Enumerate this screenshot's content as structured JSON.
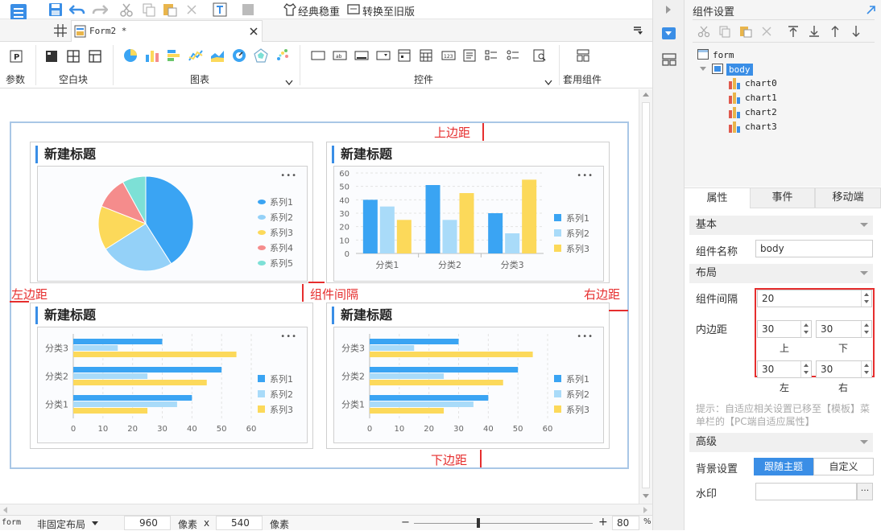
{
  "toolbar": {
    "classic_label": "经典稳重",
    "switch_label": "转换至旧版"
  },
  "tab": {
    "title": "Form2 *"
  },
  "ribbon": {
    "groups": [
      "参数",
      "空白块",
      "图表",
      "控件",
      "套用组件"
    ]
  },
  "canvas": {
    "labels": {
      "top": "上边距",
      "bottom": "下边距",
      "left": "左边距",
      "right": "右边距",
      "gap": "组件间隔"
    },
    "cards": [
      {
        "title": "新建标题"
      },
      {
        "title": "新建标题"
      },
      {
        "title": "新建标题"
      },
      {
        "title": "新建标题"
      }
    ],
    "more": "•••"
  },
  "chart_data": [
    {
      "type": "pie",
      "title": "新建标题",
      "categories": [
        "系列1",
        "系列2",
        "系列3",
        "系列4",
        "系列5"
      ],
      "values": [
        41,
        25,
        15,
        11,
        8
      ],
      "colors": [
        "#3aa4f3",
        "#94d1f8",
        "#fcd95a",
        "#f58c8c",
        "#7de0d6"
      ],
      "legend": "right"
    },
    {
      "type": "bar",
      "title": "新建标题",
      "categories": [
        "分类1",
        "分类2",
        "分类3"
      ],
      "series": [
        {
          "name": "系列1",
          "values": [
            40,
            51,
            30
          ],
          "color": "#3aa4f3"
        },
        {
          "name": "系列2",
          "values": [
            35,
            25,
            15
          ],
          "color": "#a9dbf9"
        },
        {
          "name": "系列3",
          "values": [
            25,
            45,
            55
          ],
          "color": "#fcd95a"
        }
      ],
      "ylim": [
        0,
        60
      ],
      "yticks": [
        "0",
        "10",
        "20",
        "30",
        "40",
        "50",
        "60"
      ],
      "legend": "right"
    },
    {
      "type": "bar",
      "orientation": "horizontal",
      "title": "新建标题",
      "categories": [
        "分类1",
        "分类2",
        "分类3"
      ],
      "series": [
        {
          "name": "系列1",
          "values": [
            40,
            50,
            30
          ],
          "color": "#3aa4f3"
        },
        {
          "name": "系列2",
          "values": [
            35,
            25,
            15
          ],
          "color": "#a9dbf9"
        },
        {
          "name": "系列3",
          "values": [
            25,
            45,
            55
          ],
          "color": "#fcd95a"
        }
      ],
      "xlim": [
        0,
        60
      ],
      "xticks": [
        "0",
        "10",
        "20",
        "30",
        "40",
        "50",
        "60"
      ],
      "legend": "right"
    },
    {
      "type": "bar",
      "orientation": "horizontal",
      "title": "新建标题",
      "categories": [
        "分类1",
        "分类2",
        "分类3"
      ],
      "series": [
        {
          "name": "系列1",
          "values": [
            40,
            50,
            30
          ],
          "color": "#3aa4f3"
        },
        {
          "name": "系列2",
          "values": [
            35,
            25,
            15
          ],
          "color": "#a9dbf9"
        },
        {
          "name": "系列3",
          "values": [
            25,
            45,
            55
          ],
          "color": "#fcd95a"
        }
      ],
      "xlim": [
        0,
        60
      ],
      "xticks": [
        "0",
        "10",
        "20",
        "30",
        "40",
        "50",
        "60"
      ],
      "legend": "right"
    }
  ],
  "statusbar": {
    "form": "form",
    "layout": "非固定布局",
    "width": "960",
    "unit1": "像素",
    "x": "x",
    "height": "540",
    "unit2": "像素",
    "minus": "−",
    "plus": "+",
    "zoom": "80",
    "percent": "%"
  },
  "panel": {
    "title": "组件设置",
    "tree": [
      "form",
      "body",
      "chart0",
      "chart1",
      "chart2",
      "chart3"
    ],
    "tabs": [
      "属性",
      "事件",
      "移动端"
    ],
    "sections": {
      "basic": "基本",
      "layout": "布局",
      "advanced": "高级"
    },
    "name_label": "组件名称",
    "name_value": "body",
    "gap_label": "组件间隔",
    "gap_value": "20",
    "padding_label": "内边距",
    "pad_top": "30",
    "pad_bottom": "30",
    "pad_left": "30",
    "pad_right": "30",
    "lbl_top": "上",
    "lbl_bottom": "下",
    "lbl_left": "左",
    "lbl_right": "右",
    "hint": "提示：自适应相关设置已移至【模板】菜单栏的【PC端自适应属性】",
    "bg_label": "背景设置",
    "bg_follow": "跟随主题",
    "bg_custom": "自定义",
    "watermark_label": "水印",
    "watermark_btn": "···"
  }
}
